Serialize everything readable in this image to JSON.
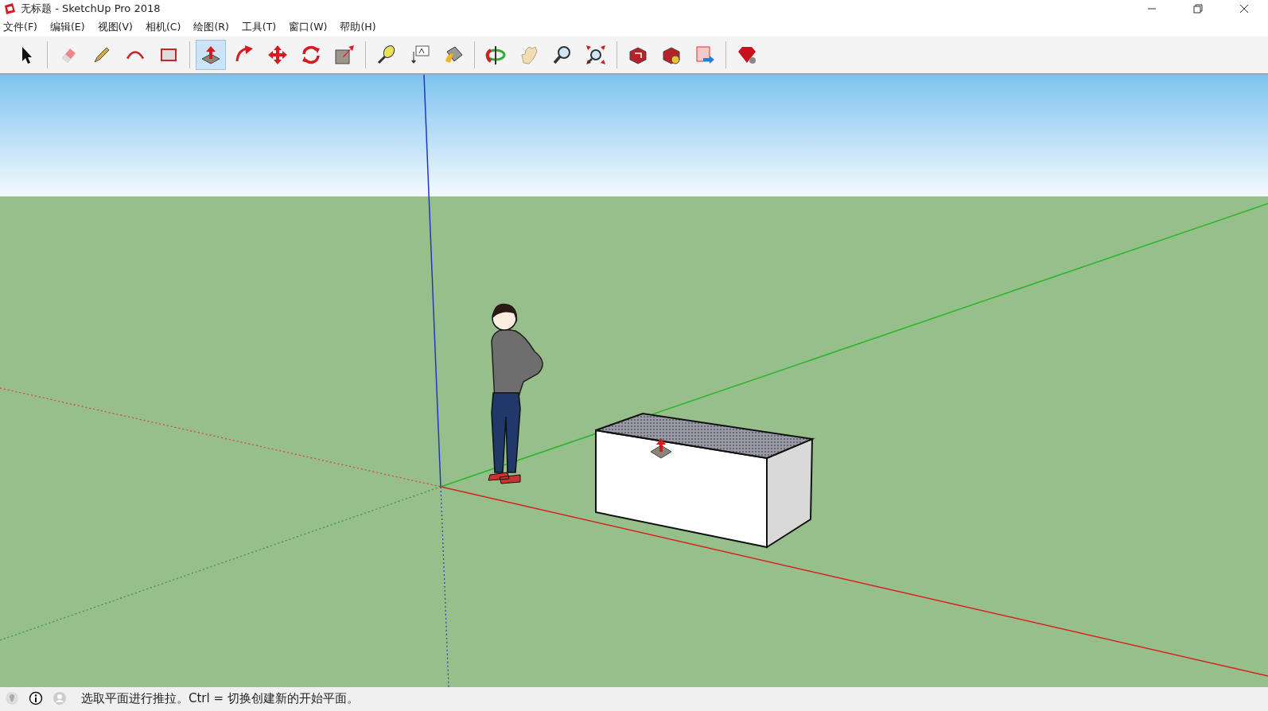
{
  "window": {
    "title": "无标题 - SketchUp Pro 2018"
  },
  "menu": [
    "文件(F)",
    "编辑(E)",
    "视图(V)",
    "相机(C)",
    "绘图(R)",
    "工具(T)",
    "窗口(W)",
    "帮助(H)"
  ],
  "toolbar": [
    {
      "kind": "select",
      "selected": false
    },
    {
      "kind": "separator"
    },
    {
      "kind": "eraser",
      "selected": false
    },
    {
      "kind": "line",
      "selected": false
    },
    {
      "kind": "arc",
      "selected": false
    },
    {
      "kind": "rectangle",
      "selected": false
    },
    {
      "kind": "separator"
    },
    {
      "kind": "pushpull",
      "selected": true
    },
    {
      "kind": "followme",
      "selected": false
    },
    {
      "kind": "move",
      "selected": false
    },
    {
      "kind": "rotate",
      "selected": false
    },
    {
      "kind": "scale",
      "selected": false
    },
    {
      "kind": "separator"
    },
    {
      "kind": "tape",
      "selected": false
    },
    {
      "kind": "text",
      "selected": false
    },
    {
      "kind": "paint",
      "selected": false
    },
    {
      "kind": "separator"
    },
    {
      "kind": "orbit",
      "selected": false
    },
    {
      "kind": "pan",
      "selected": false
    },
    {
      "kind": "zoom",
      "selected": false
    },
    {
      "kind": "extents",
      "selected": false
    },
    {
      "kind": "separator"
    },
    {
      "kind": "warehouse",
      "selected": false
    },
    {
      "kind": "extensions",
      "selected": false
    },
    {
      "kind": "layout",
      "selected": false
    },
    {
      "kind": "separator"
    },
    {
      "kind": "ruby",
      "selected": false
    }
  ],
  "status_bar": {
    "icons": [
      {
        "kind": "geo"
      },
      {
        "kind": "info"
      },
      {
        "kind": "user"
      }
    ],
    "message": "选取平面进行推拉。Ctrl = 切换创建新的开始平面。"
  }
}
